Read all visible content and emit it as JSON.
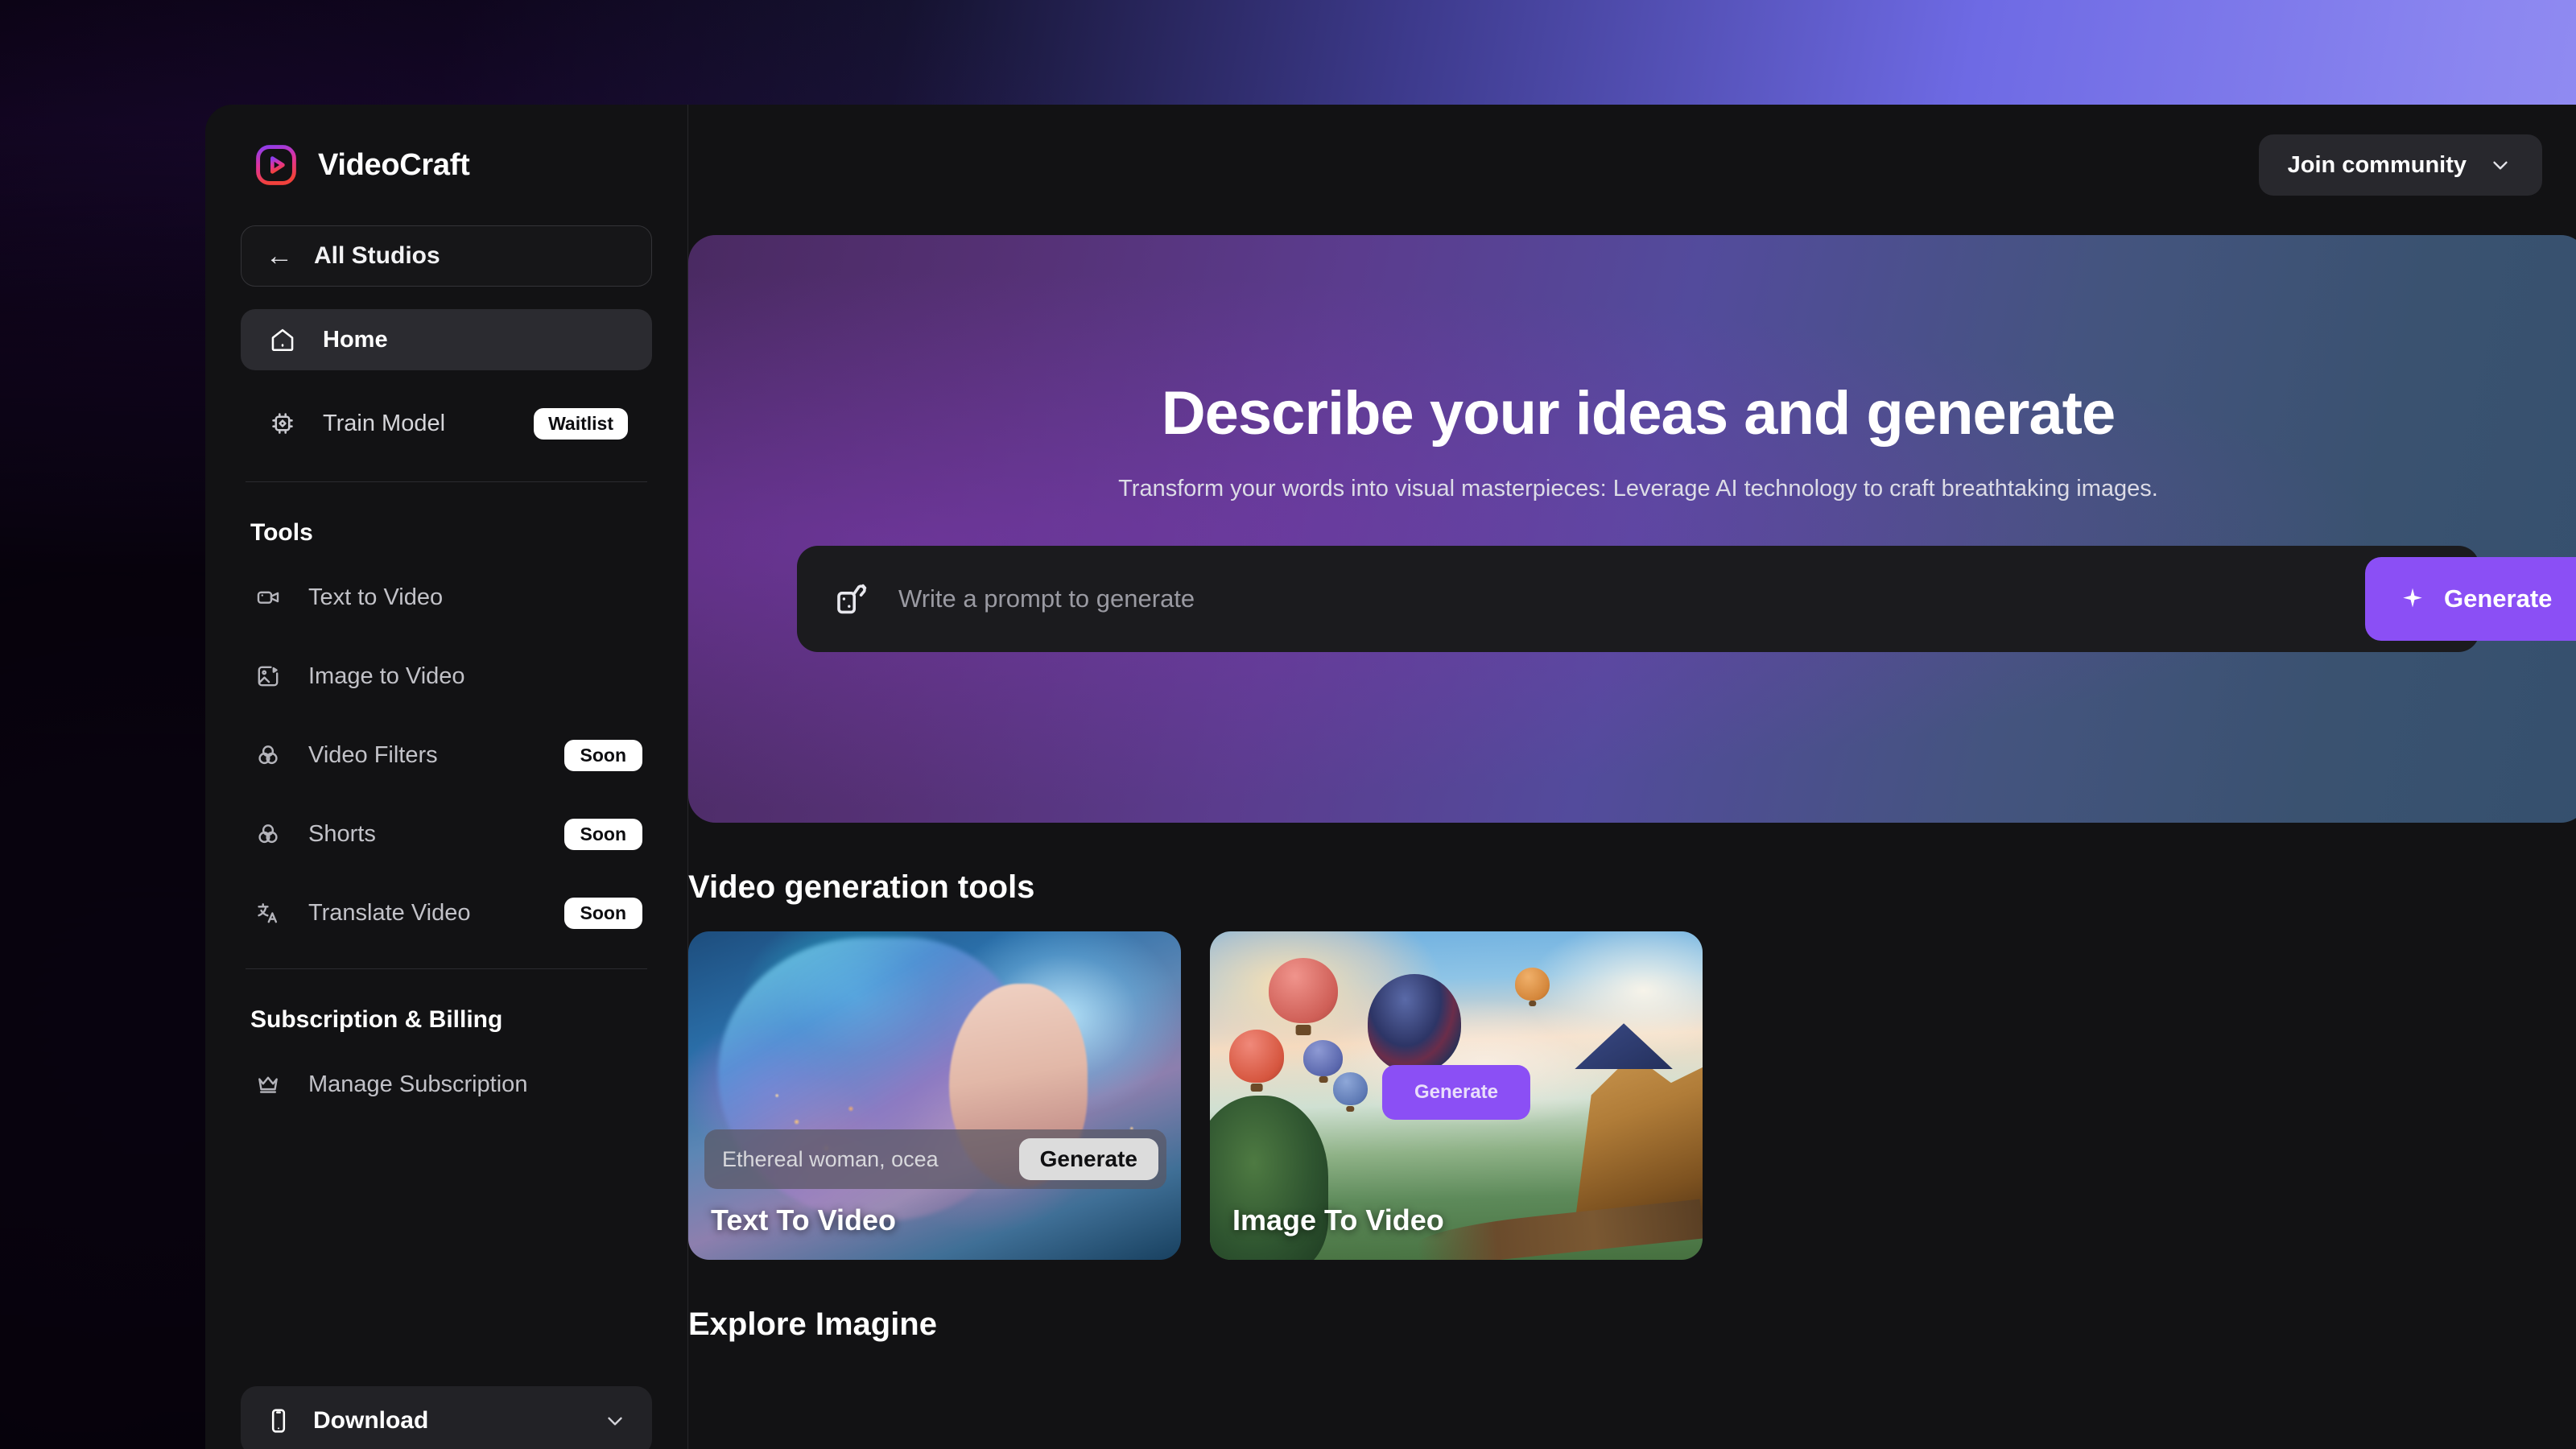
{
  "brand": {
    "name": "VideoCraft",
    "logo_icon": "play-square-gradient-icon"
  },
  "sidebar": {
    "studios_button": {
      "label": "All Studios",
      "icon": "arrow-left-icon"
    },
    "primary_nav": [
      {
        "label": "Home",
        "icon": "home-icon",
        "active": true,
        "badge": ""
      },
      {
        "label": "Train Model",
        "icon": "chip-icon",
        "active": false,
        "badge": "Waitlist"
      }
    ],
    "tools_section_title": "Tools",
    "tools": [
      {
        "label": "Text to Video",
        "icon": "video-camera-icon",
        "badge": ""
      },
      {
        "label": "Image to Video",
        "icon": "image-play-icon",
        "badge": ""
      },
      {
        "label": "Video Filters",
        "icon": "filters-icon",
        "badge": "Soon"
      },
      {
        "label": "Shorts",
        "icon": "filters-icon",
        "badge": "Soon"
      },
      {
        "label": "Translate Video",
        "icon": "translate-icon",
        "badge": "Soon"
      }
    ],
    "billing_section_title": "Subscription & Billing",
    "billing": [
      {
        "label": "Manage Subscription",
        "icon": "crown-icon",
        "badge": ""
      }
    ],
    "download_button": {
      "label": "Download",
      "icon": "phone-icon",
      "chevron": "chevron-down-icon"
    }
  },
  "topbar": {
    "community_button": {
      "label": "Join community",
      "chevron": "chevron-down-icon"
    }
  },
  "hero": {
    "title": "Describe your ideas and generate",
    "subtitle": "Transform your words into visual masterpieces: Leverage AI technology to craft breathtaking images.",
    "prompt_placeholder": "Write a prompt to generate",
    "prompt_value": "",
    "prompt_icon": "dice-shuffle-icon",
    "generate_button": {
      "label": "Generate",
      "icon": "sparkle-icon",
      "color": "#8b4ff5"
    }
  },
  "sections": {
    "video_tools_title": "Video generation tools",
    "explore_title": "Explore Imagine"
  },
  "cards": [
    {
      "title": "Text To Video",
      "prompt_text": "Ethereal woman, ocea",
      "button_label": "Generate",
      "button_style": "light"
    },
    {
      "title": "Image To Video",
      "prompt_text": "",
      "button_label": "Generate",
      "button_style": "purple"
    }
  ],
  "colors": {
    "accent_purple": "#8b4ff5",
    "app_bg": "#121214",
    "sidebar_bg": "#121214",
    "badge_bg": "#ffffff"
  }
}
